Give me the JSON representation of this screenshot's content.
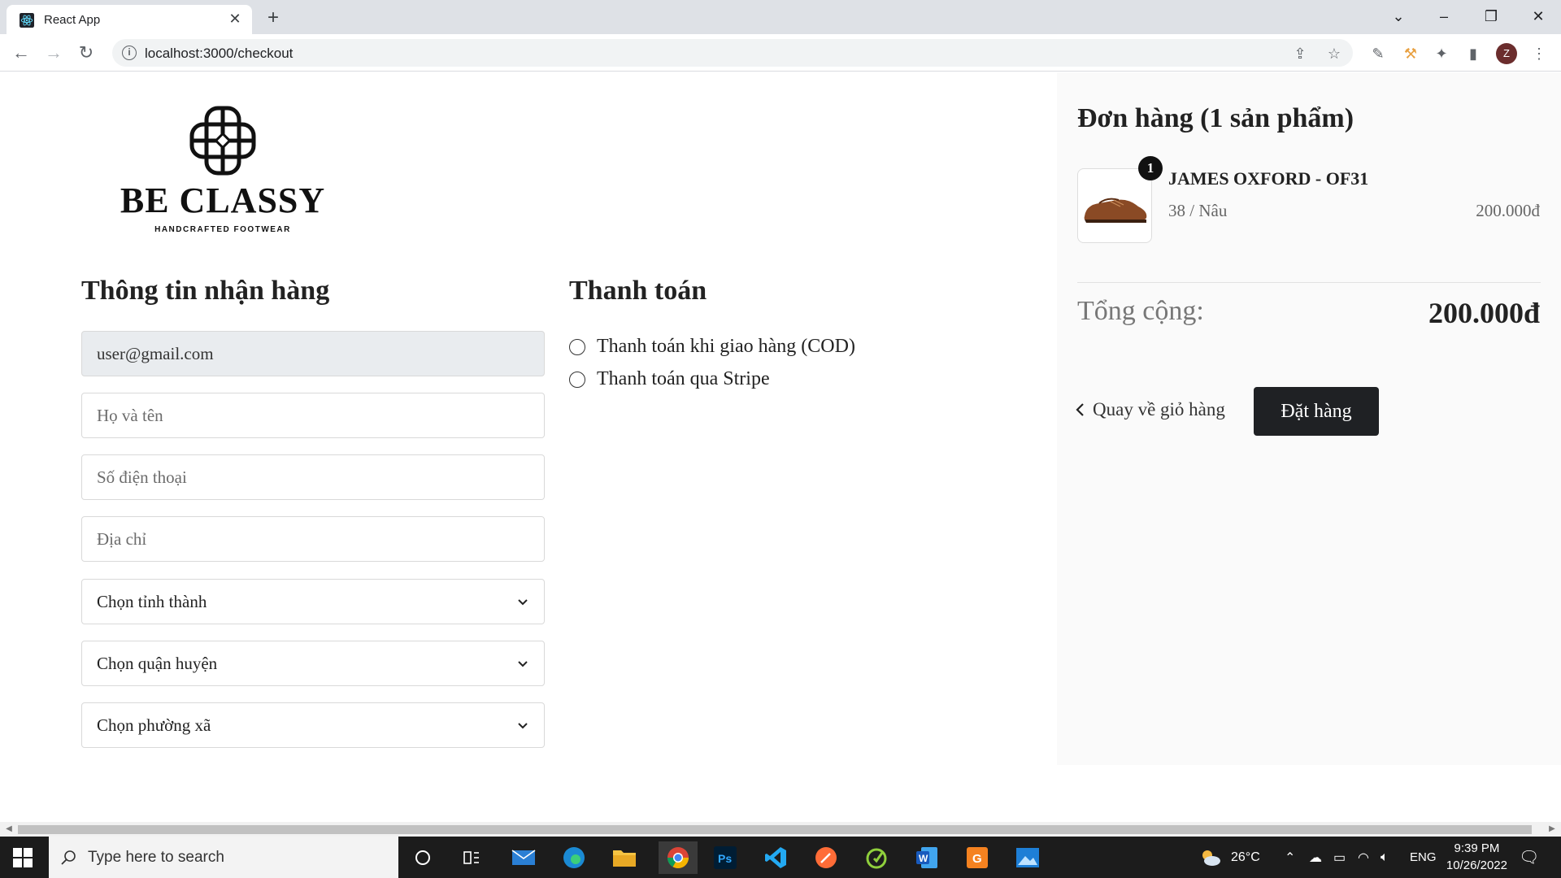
{
  "browser": {
    "tab_title": "React App",
    "url": "localhost:3000/checkout",
    "profile_initial": "Z"
  },
  "brand": {
    "name": "BE CLASSY",
    "tagline": "HANDCRAFTED FOOTWEAR"
  },
  "shipping": {
    "title": "Thông tin nhận hàng",
    "email_value": "user@gmail.com",
    "fullname_placeholder": "Họ và tên",
    "phone_placeholder": "Số điện thoại",
    "address_placeholder": "Địa chỉ",
    "province_select": "Chọn tỉnh thành",
    "district_select": "Chọn quận huyện",
    "ward_select": "Chọn phường xã"
  },
  "payment": {
    "title": "Thanh toán",
    "options": [
      "Thanh toán khi giao hàng (COD)",
      "Thanh toán qua Stripe"
    ]
  },
  "order": {
    "title": "Đơn hàng (1 sản phẩm)",
    "item": {
      "quantity": "1",
      "name": "JAMES OXFORD - OF31",
      "variant": "38 / Nâu",
      "price": "200.000đ"
    },
    "total_label": "Tổng cộng:",
    "total_value": "200.000đ",
    "back_label": "Quay về giỏ hàng",
    "submit_label": "Đặt hàng"
  },
  "taskbar": {
    "search_placeholder": "Type here to search",
    "weather": "26°C",
    "language": "ENG",
    "time": "9:39 PM",
    "date": "10/26/2022"
  },
  "colors": {
    "accent_button": "#1f2124",
    "order_panel_bg": "#fafafa",
    "filled_input_bg": "#e9ecef"
  }
}
